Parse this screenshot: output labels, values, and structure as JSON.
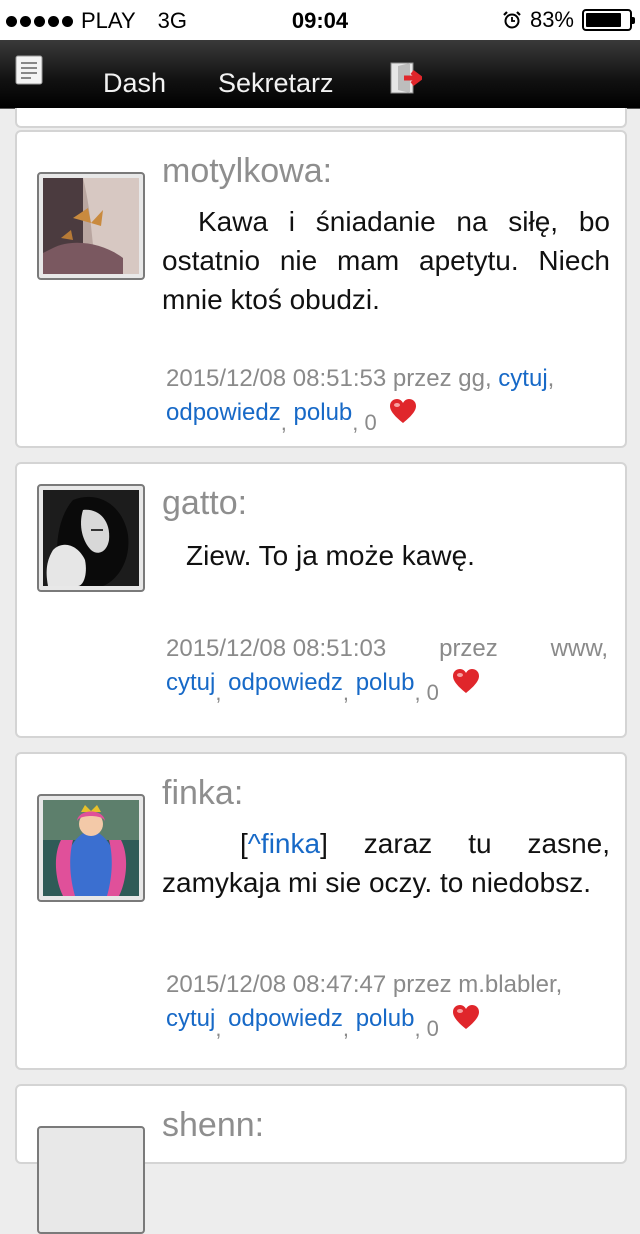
{
  "status_bar": {
    "carrier": "PLAY",
    "network": "3G",
    "time": "09:04",
    "battery": "83%",
    "battery_level": 0.83
  },
  "nav": {
    "dash": "Dash",
    "sekretarz": "Sekretarz"
  },
  "posts": [
    {
      "user": "motylkowa:",
      "message": "Kawa i śniadanie na siłę, bo ostatnio nie mam apetytu. Niech mnie ktoś obudzi.",
      "datetime": "2015/12/08  08:51:53",
      "by_label": "przez",
      "author": "gg,",
      "quote": "cytuj",
      "reply": "odpowiedz",
      "like": "polub",
      "likes": "0"
    },
    {
      "user": "gatto:",
      "message": "Ziew. To ja może kawę.",
      "datetime": "2015/12/08  08:51:03",
      "by_label": "przez",
      "author": "www,",
      "quote": "cytuj",
      "reply": "odpowiedz",
      "like": "polub",
      "likes": "0"
    },
    {
      "user": "finka:",
      "mention": "^finka",
      "message_after": "] zaraz tu zasne, zamykaja mi sie oczy. to niedobsz.",
      "datetime": "2015/12/08 08:47:47",
      "by_label": "przez",
      "author": "m.blabler,",
      "quote": "cytuj",
      "reply": "odpowiedz",
      "like": "polub",
      "likes": "0"
    },
    {
      "user": "shenn:"
    }
  ],
  "colors": {
    "link": "#1769c7",
    "username": "#8e8e8e",
    "heart": "#e0262b"
  }
}
